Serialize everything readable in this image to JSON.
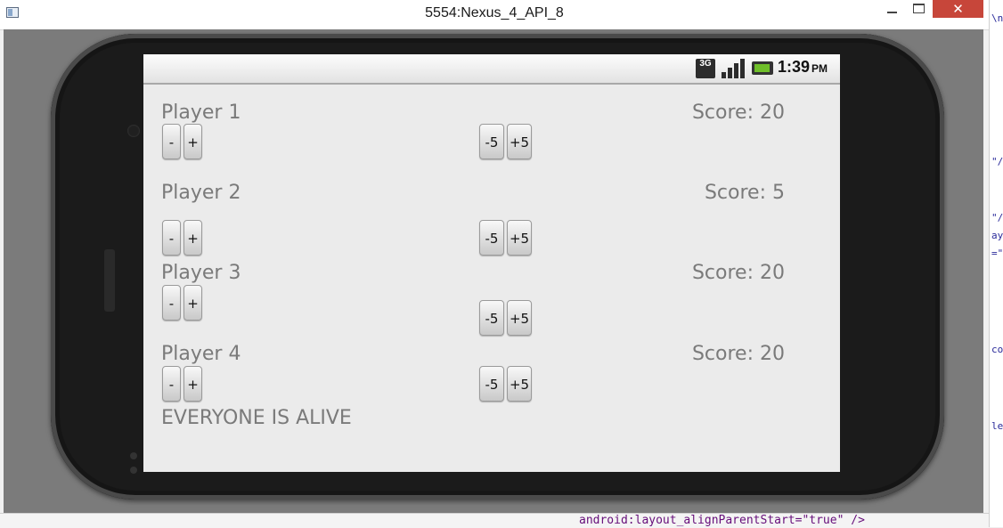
{
  "window": {
    "title": "5554:Nexus_4_API_8",
    "close_glyph": "✕"
  },
  "statusbar": {
    "network": "3G",
    "time": "1:39",
    "ampm": "PM"
  },
  "players": [
    {
      "name": "Player 1",
      "score": "Score: 20",
      "minus": "-",
      "plus": "+",
      "minus5": "-5",
      "plus5": "+5"
    },
    {
      "name": "Player 2",
      "score": "Score: 5",
      "minus": "-",
      "plus": "+",
      "minus5": "-5",
      "plus5": "+5"
    },
    {
      "name": "Player 3",
      "score": "Score: 20",
      "minus": "-",
      "plus": "+",
      "minus5": "-5",
      "plus5": "+5"
    },
    {
      "name": "Player 4",
      "score": "Score: 20",
      "minus": "-",
      "plus": "+",
      "minus5": "-5",
      "plus5": "+5"
    }
  ],
  "status_message": "EVERYONE IS ALIVE",
  "background_ide": {
    "code_line": "android:layout_alignParentStart=\"true\" />",
    "strip_fragments": [
      "\\n",
      "\"/a",
      "\"/",
      "ayo",
      "=\"(",
      "co",
      "le"
    ]
  }
}
